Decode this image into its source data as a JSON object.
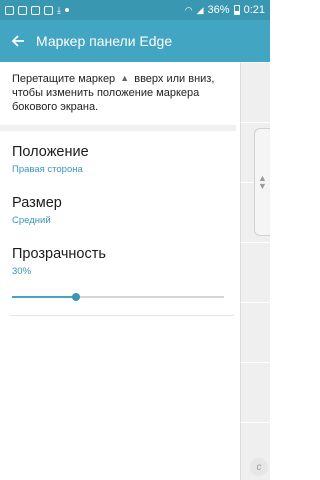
{
  "status_bar": {
    "battery": "36%",
    "time": "0:21",
    "icons": [
      "image-icon",
      "image-icon",
      "bag-icon",
      "bag-icon",
      "download-icon",
      "dot-icon",
      "wifi-icon",
      "signal-icon",
      "battery-icon"
    ]
  },
  "app_bar": {
    "title": "Маркер панели Edge",
    "back_icon": "back-arrow-icon"
  },
  "description": {
    "part1": "Перетащите маркер",
    "handle_icon": "drag-handle-icon",
    "part2": "вверх или вниз, чтобы изменить положение маркера бокового экрана."
  },
  "settings": [
    {
      "title": "Положение",
      "value": "Правая сторона"
    },
    {
      "title": "Размер",
      "value": "Средний"
    },
    {
      "title": "Прозрачность",
      "value": "30%"
    }
  ],
  "transparency_slider": {
    "fraction": 0.3
  },
  "colors": {
    "accent": "#42a5c1",
    "status_bar": "#3a97b2",
    "value_text": "#3a97b2"
  }
}
